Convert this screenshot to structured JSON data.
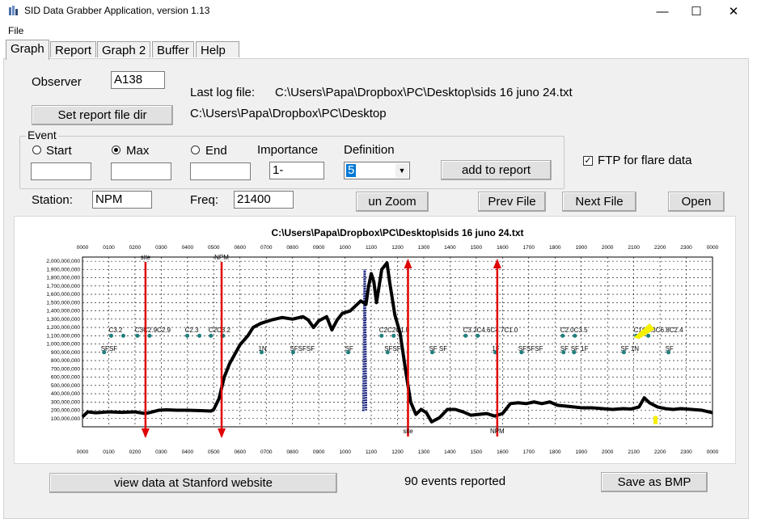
{
  "window": {
    "title": "SID Data Grabber Application, version 1.13",
    "minimize": "—",
    "maximize": "☐",
    "close": "✕"
  },
  "menu": {
    "file": "File"
  },
  "tabs": [
    "Graph",
    "Report",
    "Graph 2",
    "Buffer",
    "Help"
  ],
  "observer": {
    "label": "Observer",
    "value": "A138"
  },
  "last_log": {
    "label": "Last log file:",
    "value": "C:\\Users\\Papa\\Dropbox\\PC\\Desktop\\sids 16 juno 24.txt"
  },
  "report_dir": {
    "button": "Set report file dir",
    "value": "C:\\Users\\Papa\\Dropbox\\PC\\Desktop"
  },
  "event": {
    "group_label": "Event",
    "start_label": "Start",
    "max_label": "Max",
    "end_label": "End",
    "start_value": "",
    "max_value": "",
    "end_value": "",
    "selected": "Max",
    "importance_label": "Importance",
    "importance_value": "1-",
    "definition_label": "Definition",
    "definition_value": "5",
    "add_button": "add to report"
  },
  "ftp": {
    "label": "FTP for flare data",
    "checked": true
  },
  "station": {
    "label": "Station:",
    "value": "NPM"
  },
  "freq": {
    "label": "Freq:",
    "value": "21400"
  },
  "buttons": {
    "unzoom": "un Zoom",
    "prev": "Prev File",
    "next": "Next File",
    "open": "Open",
    "stanford": "view data at Stanford website",
    "save_bmp": "Save as BMP"
  },
  "events_reported": "90 events reported",
  "colors": {
    "signal": "#000000",
    "marker": "#e00000",
    "event_dot": "#1f7f7f",
    "dark_series": "#1a237e",
    "highlight": "#f5f000"
  },
  "chart_data": {
    "type": "line",
    "title": "C:\\Users\\Papa\\Dropbox\\PC\\Desktop\\sids 16 juno 24.txt",
    "x_ticks": [
      "0000",
      "0100",
      "0200",
      "0300",
      "0400",
      "0500",
      "0600",
      "0700",
      "0800",
      "0900",
      "1000",
      "1100",
      "1200",
      "1300",
      "1400",
      "1500",
      "1600",
      "1700",
      "1800",
      "1900",
      "2000",
      "2100",
      "2200",
      "2300",
      "0000"
    ],
    "y_ticks": [
      "100,000,000",
      "200,000,000",
      "300,000,000",
      "400,000,000",
      "500,000,000",
      "600,000,000",
      "700,000,000",
      "800,000,000",
      "900,000,000",
      "1,000,000,000",
      "1,100,000,000",
      "1,200,000,000",
      "1,300,000,000",
      "1,400,000,000",
      "1,500,000,000",
      "1,600,000,000",
      "1,700,000,000",
      "1,800,000,000",
      "1,900,000,000",
      "2,000,000,000"
    ],
    "xlim_hours": [
      0,
      24
    ],
    "ylim": [
      0,
      2050000000
    ],
    "grid": true,
    "signal": [
      [
        0.0,
        120
      ],
      [
        0.2,
        180
      ],
      [
        0.5,
        170
      ],
      [
        1.0,
        180
      ],
      [
        1.5,
        175
      ],
      [
        2.0,
        180
      ],
      [
        2.4,
        160
      ],
      [
        2.6,
        175
      ],
      [
        2.9,
        200
      ],
      [
        3.2,
        205
      ],
      [
        3.6,
        200
      ],
      [
        4.0,
        200
      ],
      [
        4.5,
        195
      ],
      [
        4.9,
        190
      ],
      [
        5.0,
        210
      ],
      [
        5.2,
        340
      ],
      [
        5.4,
        600
      ],
      [
        5.6,
        760
      ],
      [
        6.0,
        990
      ],
      [
        6.3,
        1100
      ],
      [
        6.5,
        1200
      ],
      [
        6.8,
        1250
      ],
      [
        7.2,
        1290
      ],
      [
        7.6,
        1320
      ],
      [
        8.0,
        1300
      ],
      [
        8.4,
        1330
      ],
      [
        8.6,
        1290
      ],
      [
        8.8,
        1200
      ],
      [
        9.0,
        1280
      ],
      [
        9.3,
        1330
      ],
      [
        9.5,
        1170
      ],
      [
        9.7,
        1290
      ],
      [
        9.9,
        1370
      ],
      [
        10.2,
        1400
      ],
      [
        10.4,
        1460
      ],
      [
        10.6,
        1520
      ],
      [
        10.8,
        1480
      ],
      [
        10.9,
        1700
      ],
      [
        11.0,
        1850
      ],
      [
        11.1,
        1750
      ],
      [
        11.2,
        1500
      ],
      [
        11.4,
        1900
      ],
      [
        11.6,
        1980
      ],
      [
        11.7,
        1750
      ],
      [
        11.9,
        1350
      ],
      [
        12.1,
        1130
      ],
      [
        12.3,
        700
      ],
      [
        12.5,
        300
      ],
      [
        12.7,
        150
      ],
      [
        12.9,
        210
      ],
      [
        13.1,
        170
      ],
      [
        13.3,
        60
      ],
      [
        13.6,
        110
      ],
      [
        13.9,
        210
      ],
      [
        14.2,
        210
      ],
      [
        14.5,
        180
      ],
      [
        14.8,
        140
      ],
      [
        15.1,
        150
      ],
      [
        15.4,
        160
      ],
      [
        15.7,
        130
      ],
      [
        16.0,
        160
      ],
      [
        16.3,
        280
      ],
      [
        16.6,
        290
      ],
      [
        16.9,
        280
      ],
      [
        17.2,
        300
      ],
      [
        17.5,
        280
      ],
      [
        17.8,
        300
      ],
      [
        18.1,
        260
      ],
      [
        18.4,
        250
      ],
      [
        18.7,
        240
      ],
      [
        19.0,
        230
      ],
      [
        19.4,
        230
      ],
      [
        19.8,
        220
      ],
      [
        20.2,
        210
      ],
      [
        20.6,
        220
      ],
      [
        20.9,
        215
      ],
      [
        21.2,
        240
      ],
      [
        21.4,
        350
      ],
      [
        21.6,
        290
      ],
      [
        21.9,
        240
      ],
      [
        22.2,
        220
      ],
      [
        22.5,
        210
      ],
      [
        22.8,
        220
      ],
      [
        23.2,
        210
      ],
      [
        23.6,
        200
      ],
      [
        24.0,
        170
      ]
    ],
    "dark_series": [
      [
        10.7,
        190
      ],
      [
        10.75,
        1900
      ],
      [
        10.8,
        200
      ]
    ],
    "markers": [
      {
        "hour": 2.4,
        "label": "site",
        "dir": "down"
      },
      {
        "hour": 5.3,
        "label": "NPM",
        "dir": "down"
      },
      {
        "hour": 12.4,
        "label": "site",
        "dir": "up"
      },
      {
        "hour": 15.8,
        "label": "NPM",
        "dir": "up"
      }
    ],
    "upper_events": [
      "C3.2",
      "C3C2.9C2.9",
      "C2.3",
      "C2C3.2",
      "C2C2C1.0",
      "C3.2C4.6C4.7C1.0",
      "C2.0C3.5",
      "C1C2.3C6.8C2.4"
    ],
    "lower_events": [
      "SFSF",
      "1N",
      "SFSFSF",
      "SF",
      "SFSF",
      "SF SF",
      "1F",
      "SFSFSF",
      "SF",
      "SF 1F",
      "SF 1N",
      "SF"
    ]
  }
}
